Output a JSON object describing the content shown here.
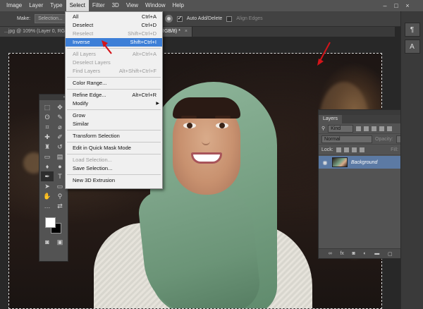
{
  "menubar": {
    "items": [
      "Image",
      "Layer",
      "Type",
      "Select",
      "Filter",
      "3D",
      "View",
      "Window",
      "Help"
    ],
    "active_index": 3,
    "window_controls": [
      "–",
      "□",
      "×"
    ]
  },
  "options": {
    "make_label": "Make:",
    "selection_btn": "Selection...",
    "auto_add_delete": "Auto Add/Delete",
    "align_edges": "Align Edges"
  },
  "tabs": [
    {
      "label": "...jpg @ 109% (Layer 0, RGB/...",
      "active": false
    },
    {
      "label": "...jpg @ 64.4% (RGB/8) *",
      "active": true
    }
  ],
  "select_menu": {
    "items": [
      {
        "label": "All",
        "shortcut": "Ctrl+A",
        "disabled": false
      },
      {
        "label": "Deselect",
        "shortcut": "Ctrl+D",
        "disabled": false
      },
      {
        "label": "Reselect",
        "shortcut": "Shift+Ctrl+D",
        "disabled": true
      },
      {
        "label": "Inverse",
        "shortcut": "Shift+Ctrl+I",
        "disabled": false,
        "highlighted": true
      },
      {
        "sep": true
      },
      {
        "label": "All Layers",
        "shortcut": "Alt+Ctrl+A",
        "disabled": true
      },
      {
        "label": "Deselect Layers",
        "shortcut": "",
        "disabled": true
      },
      {
        "label": "Find Layers",
        "shortcut": "Alt+Shift+Ctrl+F",
        "disabled": true
      },
      {
        "sep": true
      },
      {
        "label": "Color Range...",
        "shortcut": "",
        "disabled": false
      },
      {
        "sep": true
      },
      {
        "label": "Refine Edge...",
        "shortcut": "Alt+Ctrl+R",
        "disabled": false
      },
      {
        "label": "Modify",
        "shortcut": "",
        "disabled": false,
        "submenu": true
      },
      {
        "sep": true
      },
      {
        "label": "Grow",
        "shortcut": "",
        "disabled": false
      },
      {
        "label": "Similar",
        "shortcut": "",
        "disabled": false
      },
      {
        "sep": true
      },
      {
        "label": "Transform Selection",
        "shortcut": "",
        "disabled": false
      },
      {
        "sep": true
      },
      {
        "label": "Edit in Quick Mask Mode",
        "shortcut": "",
        "disabled": false
      },
      {
        "sep": true
      },
      {
        "label": "Load Selection...",
        "shortcut": "",
        "disabled": true
      },
      {
        "label": "Save Selection...",
        "shortcut": "",
        "disabled": false
      },
      {
        "sep": true
      },
      {
        "label": "New 3D Extrusion",
        "shortcut": "",
        "disabled": false
      }
    ]
  },
  "layers_panel": {
    "tab": "Layers",
    "kind_label": "Kind",
    "blend_mode": "Normal",
    "opacity_label": "Opacity:",
    "lock_label": "Lock:",
    "fill_label": "Fill:",
    "layer_name": "Background",
    "footer_icons": [
      "link-icon",
      "fx-icon",
      "mask-icon",
      "adjustment-icon",
      "folder-icon",
      "new-layer-icon",
      "trash-icon"
    ]
  },
  "colors": {
    "menu_highlight": "#3d7fd7",
    "arrow": "#d4141a",
    "layer_selected": "#5c7aa4"
  }
}
